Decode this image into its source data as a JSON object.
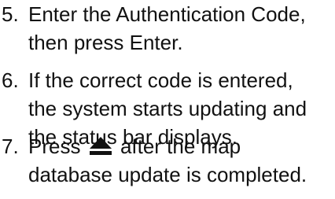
{
  "steps": [
    {
      "number": "5.",
      "lines": [
        "Enter the Authentication Code,",
        "then press Enter."
      ]
    },
    {
      "number": "6.",
      "lines": [
        "If the correct code is entered,",
        "the system starts updating and",
        "the status bar displays."
      ]
    },
    {
      "number": "7.",
      "line1_before_icon": "Press",
      "icon": "eject-icon",
      "line1_after_icon": "after the map",
      "line2": "database update is completed."
    }
  ]
}
